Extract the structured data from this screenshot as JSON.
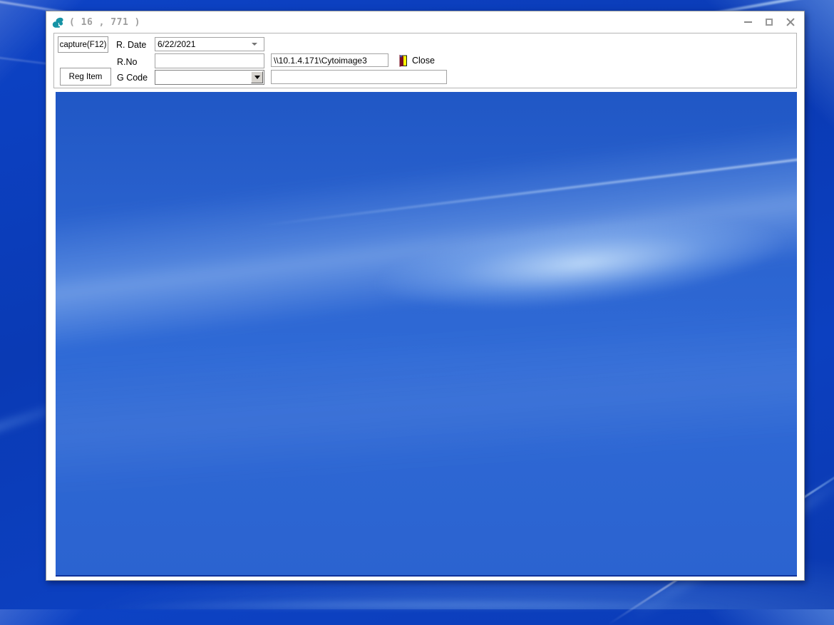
{
  "window": {
    "title": "( 16 , 771 )"
  },
  "toolbar": {
    "capture_button_label": "capture(F12)",
    "reg_item_button_label": "Reg Item",
    "close_button_label": "Close",
    "fields": {
      "r_date": {
        "label": "R. Date",
        "value": "6/22/2021"
      },
      "r_no": {
        "label": "R.No",
        "value": ""
      },
      "server_path": {
        "value": "\\\\10.1.4.171\\Cytoimage3"
      },
      "g_code": {
        "label": "G Code",
        "value": ""
      },
      "extra": {
        "value": ""
      }
    }
  },
  "icons": {
    "app_icon": "teal-blob-app-icon",
    "minimize_icon": "minimize",
    "maximize_icon": "maximize",
    "close_window_icon": "close-x",
    "exit_door_icon": "exit-door",
    "date_dropdown_icon": "flat-down-arrow",
    "combo_dropdown_icon": "classic-down-arrow-button"
  },
  "colors": {
    "desktop_blue": "#0a3cbb",
    "content_blue": "#2b63d0",
    "accent_teal": "#1693a5",
    "door_yellow": "#ffff00",
    "door_red": "#7a1020",
    "title_gray": "#9e9e9e"
  }
}
